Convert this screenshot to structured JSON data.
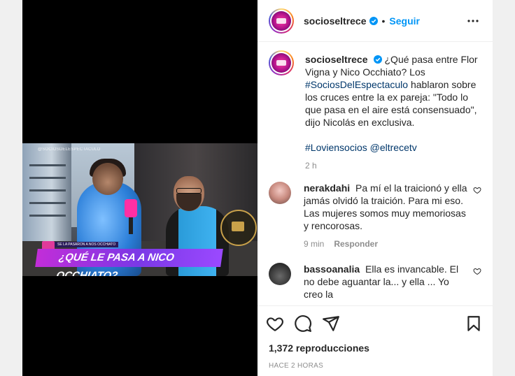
{
  "post": {
    "username": "socioseltrece",
    "separator": "•",
    "follow_label": "Seguir",
    "caption_line1": "¿Qué pasa entre Flor Vigna y Nico Occhiato? Los ",
    "caption_hashtag1": "#SociosDelEspectaculo",
    "caption_line2": " hablaron sobre los cruces entre la ex pareja: \"Todo lo que pasa en el aire está consensuado\", dijo Nicolás en exclusiva.",
    "caption_hashtag2": "#Loviensocios",
    "caption_mention": "@eltrecetv",
    "caption_time": "2 h"
  },
  "video": {
    "watermark": "@SOCIOSDELESPECTACULO",
    "lower_third_small": "SE LA PASARON A NOS OCCHIATO",
    "banner_text": "¿QUÉ LE PASA A NICO OCCHIATO?"
  },
  "comments": [
    {
      "username": "nerakdahi",
      "text": "Pa mí el la traicionó y ella jamás olvidó la traición. Para mi eso. Las mujeres somos muy memoriosas y rencorosas.",
      "time": "9 min",
      "reply_label": "Responder"
    },
    {
      "username": "bassoanalia",
      "text": "Ella es invancable. El no debe aguantar la... y ella ... Yo creo la"
    }
  ],
  "footer": {
    "views": "1,372 reproducciones",
    "timestamp": "HACE 2 HORAS"
  },
  "icons": [
    "heart-icon",
    "comment-icon",
    "share-icon",
    "save-icon",
    "more-icon",
    "verified-icon"
  ],
  "colors": {
    "accent": "#0095f6",
    "text": "#262626",
    "muted": "#8e8e8e",
    "banner": "#7a38e6"
  }
}
